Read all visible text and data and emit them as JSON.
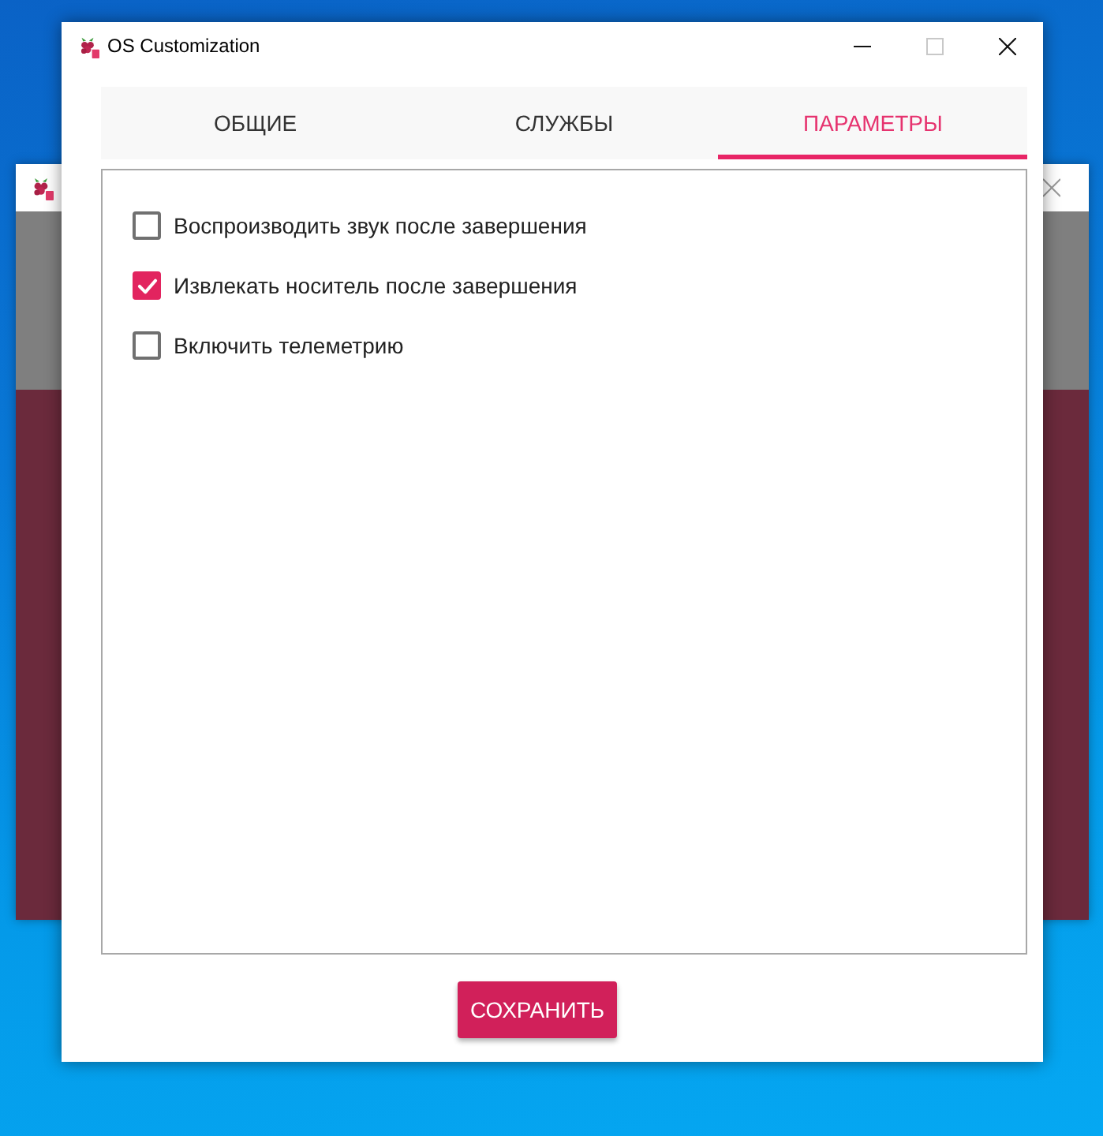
{
  "window": {
    "title": "OS Customization",
    "controls": [
      {
        "kind": "minimize",
        "disabled": false
      },
      {
        "kind": "maximize",
        "disabled": true
      },
      {
        "kind": "close",
        "disabled": false
      }
    ]
  },
  "tabs": [
    {
      "label": "ОБЩИЕ",
      "selected": false
    },
    {
      "label": "СЛУЖБЫ",
      "selected": false
    },
    {
      "label": "ПАРАМЕТРЫ",
      "selected": true
    }
  ],
  "options": [
    {
      "label": "Воспроизводить звук после завершения",
      "checked": false
    },
    {
      "label": "Извлекать носитель после завершения",
      "checked": true
    },
    {
      "label": "Включить телеметрию",
      "checked": false
    }
  ],
  "buttons": [
    {
      "label": "СОХРАНИТЬ"
    }
  ]
}
